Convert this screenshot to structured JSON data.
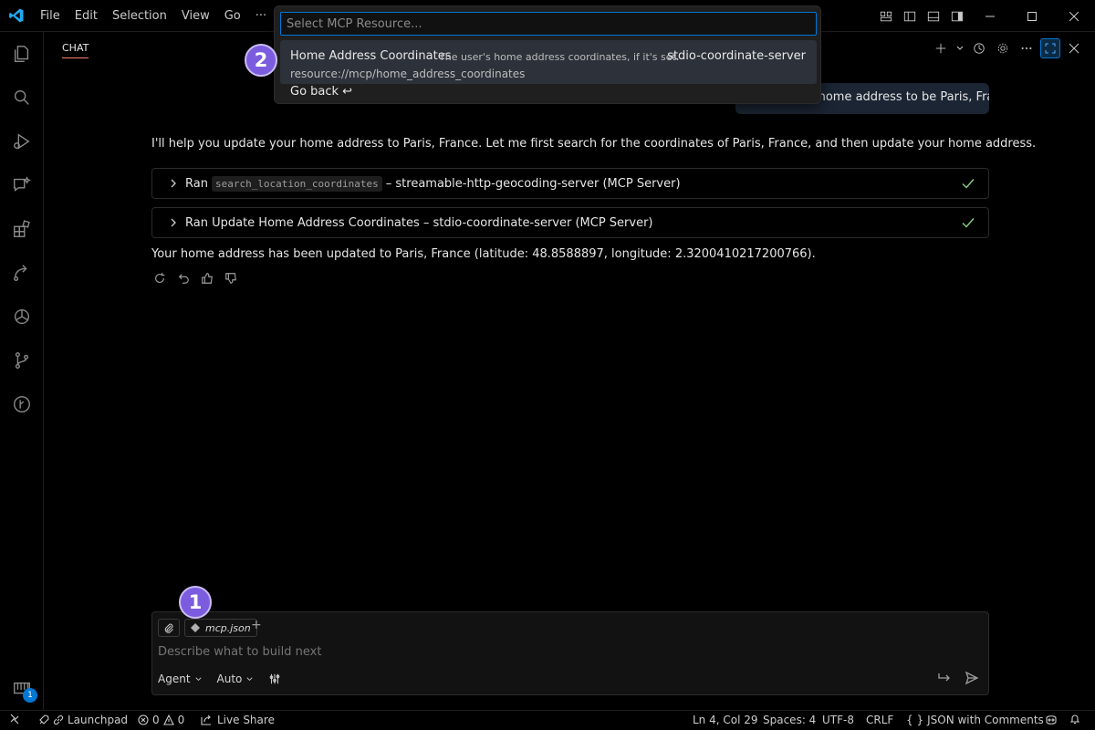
{
  "menu": [
    "File",
    "Edit",
    "Selection",
    "View",
    "Go",
    "···"
  ],
  "chat": {
    "tab_label": "CHAT",
    "user_message": "...pdate my home address to be Paris, France",
    "response_intro": "I'll help you update your home address to Paris, France. Let me first search for the coordinates of Paris, France, and then update your home address.",
    "tool_runs": [
      {
        "prefix": "Ran",
        "code": "search_location_coordinates",
        "suffix": "– streamable-http-geocoding-server (MCP Server)"
      },
      {
        "prefix": "Ran Update Home Address Coordinates – stdio-coordinate-server (MCP Server)"
      }
    ],
    "response_final": "Your home address has been updated to Paris, France (latitude: 48.8588897, longitude: 2.3200410217200766)."
  },
  "quickpick": {
    "placeholder": "Select MCP Resource...",
    "item": {
      "title": "Home Address Coordinates",
      "description": "The user's home address coordinates, if it's set.",
      "server": "stdio-coordinate-server",
      "uri": "resource://mcp/home_address_coordinates"
    },
    "back_label": "Go back ↩"
  },
  "markers": {
    "one": "1",
    "two": "2"
  },
  "input": {
    "file_chip": "mcp.json",
    "placeholder": "Describe what to build next",
    "mode": "Agent",
    "model": "Auto"
  },
  "activity_badge": "1",
  "statusbar": {
    "launchpad": "Launchpad",
    "errors": "0",
    "warnings": "0",
    "live_share": "Live Share",
    "position": "Ln 4, Col 29",
    "spaces": "Spaces: 4",
    "encoding": "UTF-8",
    "eol": "CRLF",
    "language": "JSON with Comments",
    "language_braces": "{ }"
  },
  "colors": {
    "accent": "#0078d4",
    "marker": "#7c5cde",
    "check": "#89d185"
  }
}
